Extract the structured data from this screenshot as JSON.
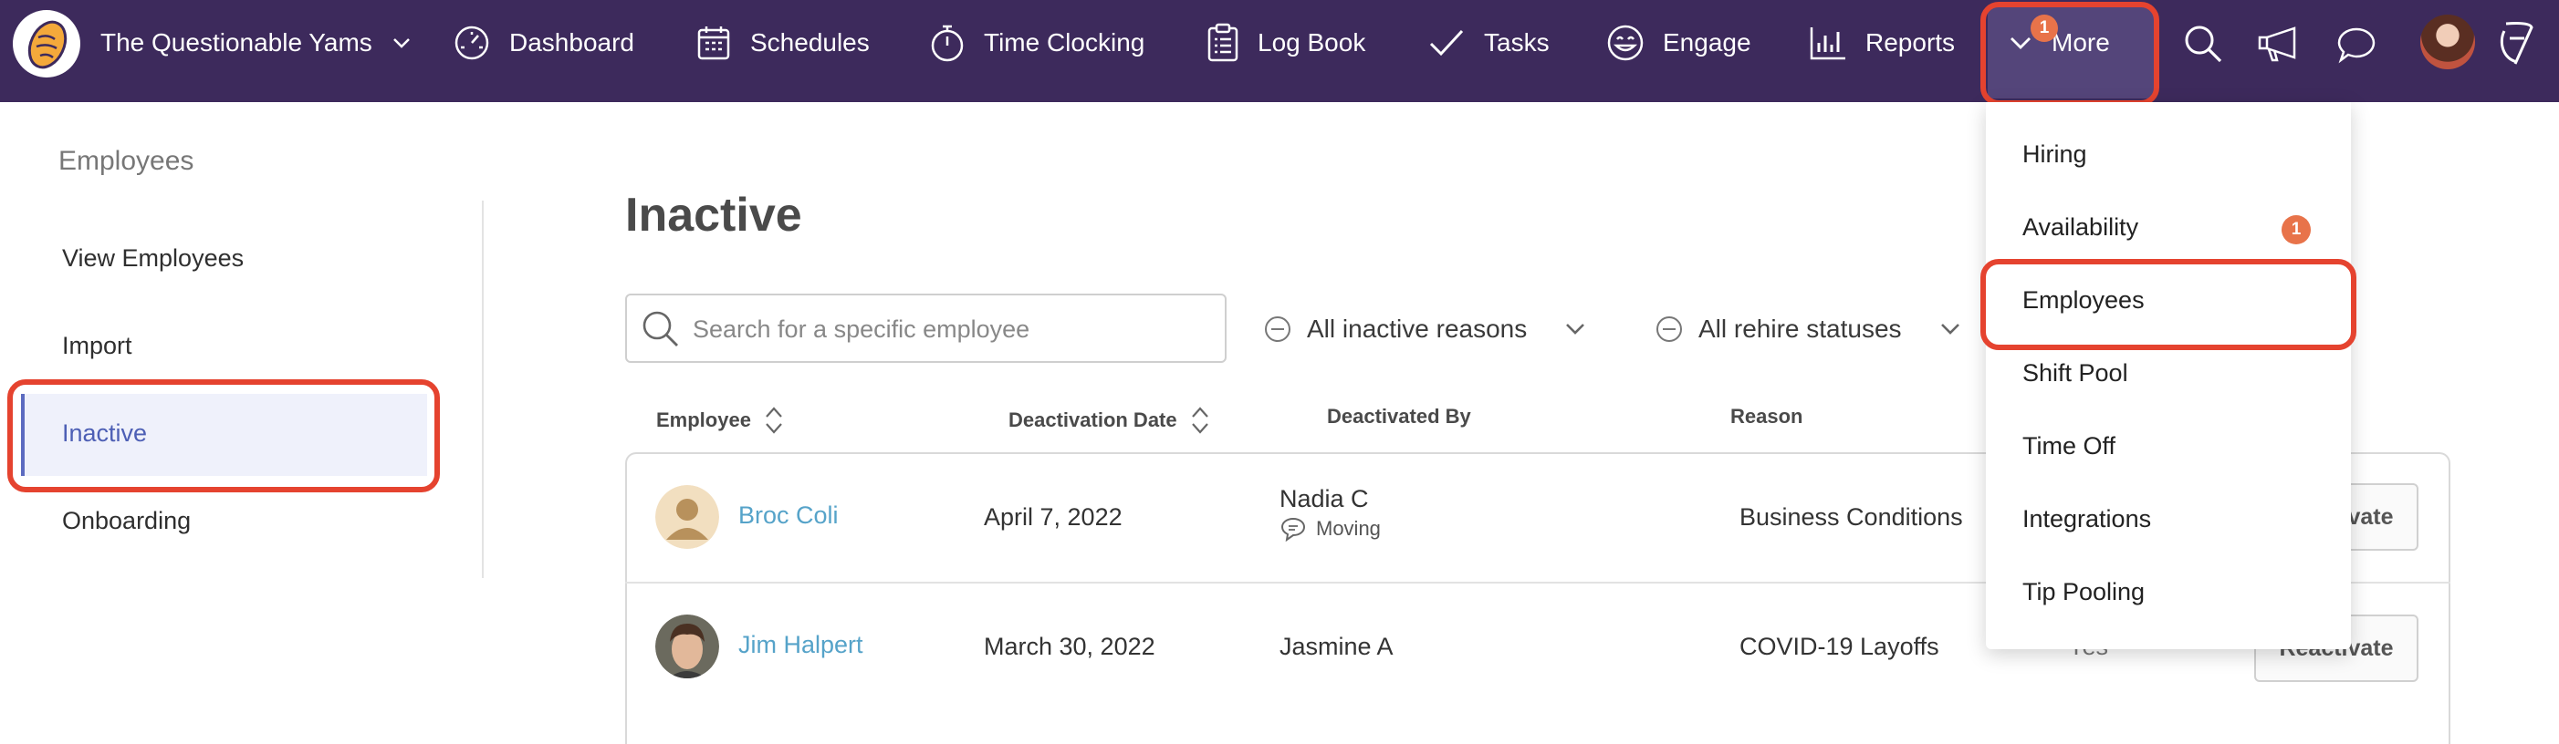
{
  "nav": {
    "org_name": "The Questionable Yams",
    "items": [
      {
        "label": "Dashboard"
      },
      {
        "label": "Schedules"
      },
      {
        "label": "Time Clocking"
      },
      {
        "label": "Log Book"
      },
      {
        "label": "Tasks"
      },
      {
        "label": "Engage"
      },
      {
        "label": "Reports"
      },
      {
        "label": "More",
        "badge": "1"
      }
    ]
  },
  "sidebar": {
    "title": "Employees",
    "items": [
      {
        "label": "View Employees"
      },
      {
        "label": "Import"
      },
      {
        "label": "Inactive",
        "active": true
      },
      {
        "label": "Onboarding"
      }
    ]
  },
  "main": {
    "title": "Inactive",
    "search": {
      "placeholder": "Search for a specific employee",
      "value": ""
    },
    "filters": [
      {
        "label": "All inactive reasons"
      },
      {
        "label": "All rehire statuses"
      }
    ],
    "columns": [
      "Employee",
      "Deactivation Date",
      "Deactivated By",
      "Reason"
    ],
    "rows": [
      {
        "name": "Broc Coli",
        "date": "April 7, 2022",
        "by": "Nadia C",
        "note": "Moving",
        "reason": "Business Conditions",
        "rehire": "",
        "action": "Reactivate"
      },
      {
        "name": "Jim Halpert",
        "date": "March 30, 2022",
        "by": "Jasmine A",
        "note": "",
        "reason": "COVID-19 Layoffs",
        "rehire": "Yes",
        "action": "Reactivate"
      }
    ]
  },
  "more_menu": {
    "items": [
      {
        "label": "Hiring"
      },
      {
        "label": "Availability",
        "badge": "1"
      },
      {
        "label": "Employees",
        "highlighted": true
      },
      {
        "label": "Shift Pool"
      },
      {
        "label": "Time Off"
      },
      {
        "label": "Integrations"
      },
      {
        "label": "Tip Pooling"
      }
    ]
  },
  "colors": {
    "nav_bg": "#3d2a5c",
    "accent_link": "#56a3c9",
    "badge": "#e8734a",
    "highlight_outline": "#e5432f",
    "sidebar_active": "#eff1fb"
  },
  "icons": [
    "yam-logo-icon",
    "chevron-down-icon",
    "gauge-icon",
    "calendar-icon",
    "stopwatch-icon",
    "clipboard-icon",
    "checkmark-icon",
    "smiley-icon",
    "bar-chart-icon",
    "search-icon",
    "megaphone-icon",
    "chat-bubble-icon",
    "user-avatar",
    "brand-7-icon",
    "minus-circle-icon",
    "sort-icon",
    "comment-icon"
  ]
}
